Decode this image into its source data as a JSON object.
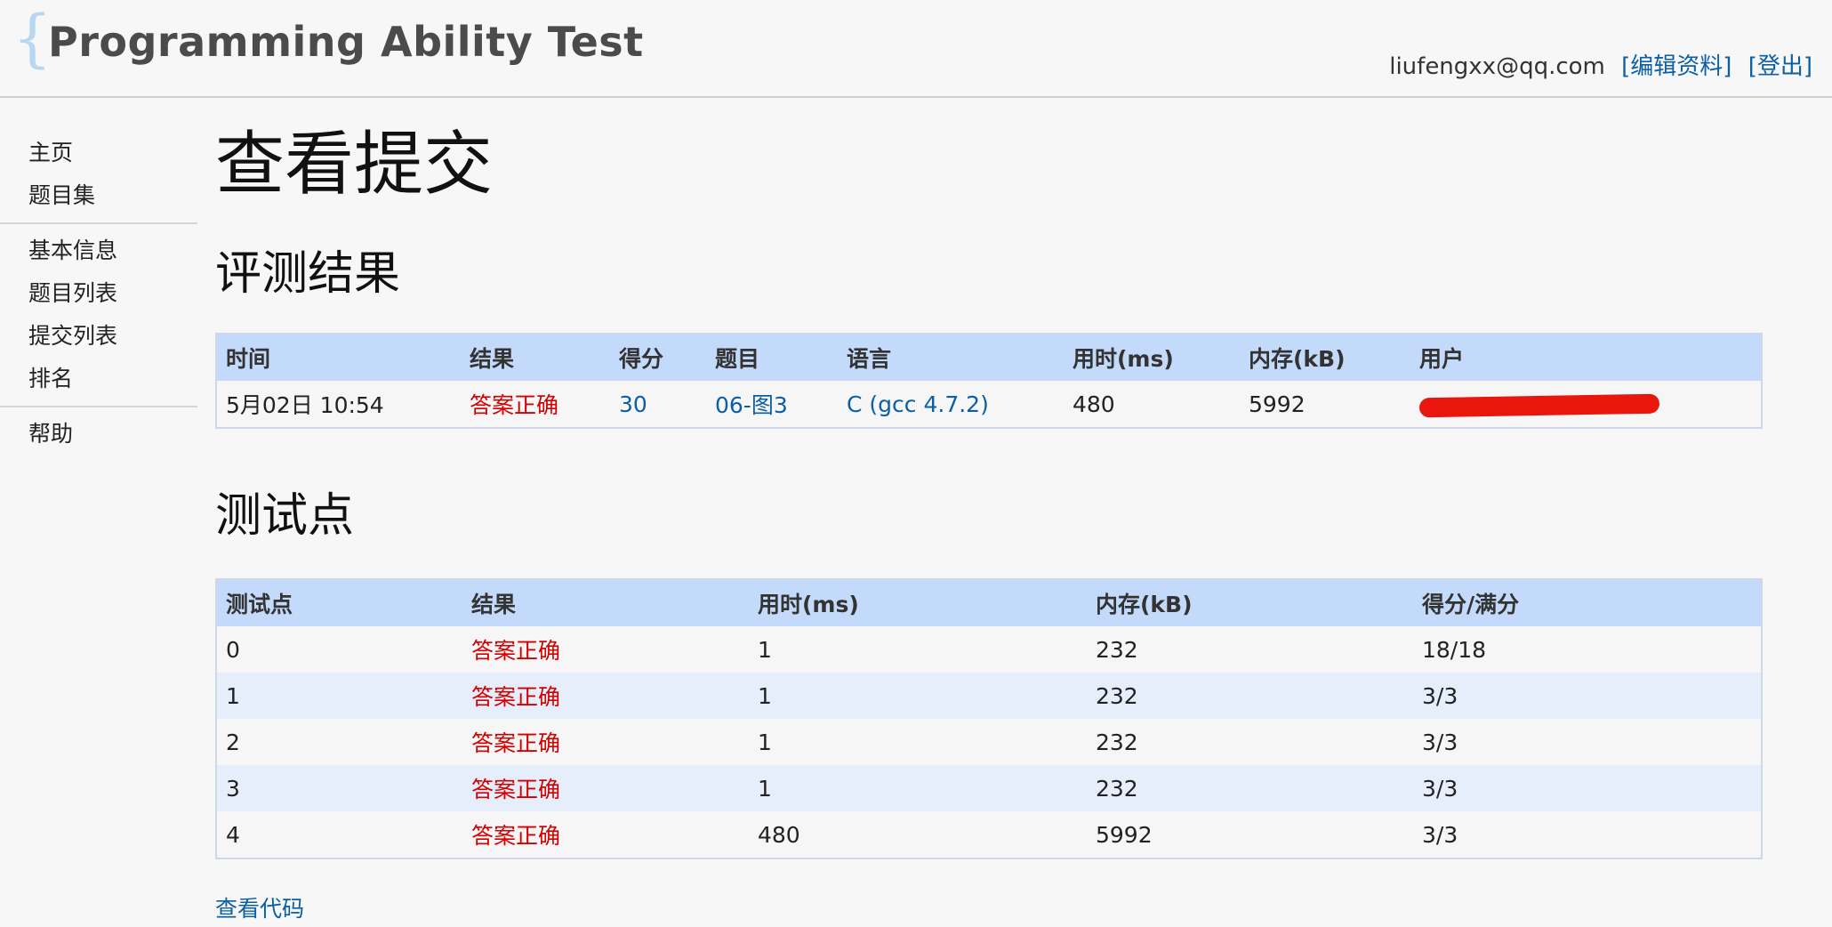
{
  "header": {
    "logo_brace": "{",
    "logo_text": "Programming Ability Test",
    "user_email": "liufengxx@qq.com",
    "edit_profile": "[编辑资料]",
    "logout": "[登出]"
  },
  "sidebar": {
    "groups": [
      [
        "主页",
        "题目集"
      ],
      [
        "基本信息",
        "题目列表",
        "提交列表",
        "排名"
      ],
      [
        "帮助"
      ]
    ]
  },
  "page_title": "查看提交",
  "judge_section": {
    "title": "评测结果",
    "headers": [
      "时间",
      "结果",
      "得分",
      "题目",
      "语言",
      "用时(ms)",
      "内存(kB)",
      "用户"
    ],
    "row": {
      "time": "5月02日 10:54",
      "result": "答案正确",
      "score": "30",
      "problem": "06-图3",
      "language": "C (gcc 4.7.2)",
      "time_ms": "480",
      "memory_kb": "5992"
    }
  },
  "tests_section": {
    "title": "测试点",
    "headers": [
      "测试点",
      "结果",
      "用时(ms)",
      "内存(kB)",
      "得分/满分"
    ],
    "rows": [
      [
        "0",
        "答案正确",
        "1",
        "232",
        "18/18"
      ],
      [
        "1",
        "答案正确",
        "1",
        "232",
        "3/3"
      ],
      [
        "2",
        "答案正确",
        "1",
        "232",
        "3/3"
      ],
      [
        "3",
        "答案正确",
        "1",
        "232",
        "3/3"
      ],
      [
        "4",
        "答案正确",
        "480",
        "5992",
        "3/3"
      ]
    ]
  },
  "view_code": "查看代码",
  "colors": {
    "accent_link": "#0b5fa5",
    "result_ok": "#d40000",
    "table_header_bg": "#c4dafb",
    "row_alt_bg": "#e6eefc"
  }
}
